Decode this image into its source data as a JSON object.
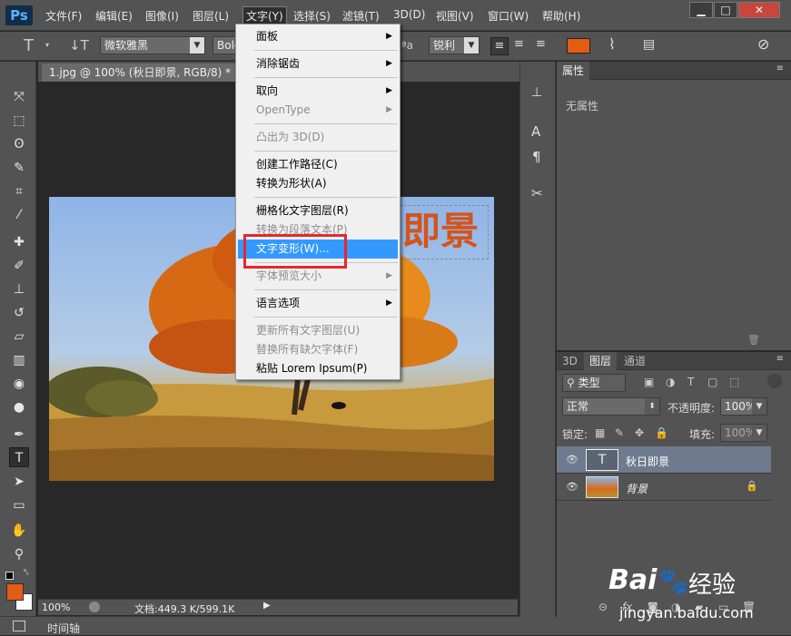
{
  "app": {
    "logo": "Ps"
  },
  "menubar": {
    "items": [
      "文件(F)",
      "编辑(E)",
      "图像(I)",
      "图层(L)",
      "文字(Y)",
      "选择(S)",
      "滤镜(T)",
      "3D(D)",
      "视图(V)",
      "窗口(W)",
      "帮助(H)"
    ],
    "active_index": 4
  },
  "window_controls": {
    "minimize": "▁",
    "maximize": "□",
    "close": "✕"
  },
  "options": {
    "font_family": "微软雅黑",
    "font_style": "Bold",
    "aa_label": "ªa",
    "antialias": "锐利",
    "color_swatch": "#e45c12"
  },
  "document": {
    "tab_title": "1.jpg @ 100% (秋日即景, RGB/8) *",
    "tab_close": "×",
    "canvas_text": "即景",
    "zoom": "100%",
    "doc_size": "文档:449.3 K/599.1K",
    "timeline_label": "时间轴"
  },
  "context_menu": {
    "items": [
      {
        "label": "面板",
        "submenu": true,
        "disabled": false
      },
      {
        "sep": true
      },
      {
        "label": "消除锯齿",
        "submenu": true,
        "disabled": false
      },
      {
        "sep": true
      },
      {
        "label": "取向",
        "submenu": true,
        "disabled": false
      },
      {
        "label": "OpenType",
        "submenu": true,
        "disabled": true
      },
      {
        "sep": true
      },
      {
        "label": "凸出为 3D(D)",
        "submenu": false,
        "disabled": true
      },
      {
        "sep": true
      },
      {
        "label": "创建工作路径(C)",
        "submenu": false,
        "disabled": false
      },
      {
        "label": "转换为形状(A)",
        "submenu": false,
        "disabled": false
      },
      {
        "sep": true
      },
      {
        "label": "栅格化文字图层(R)",
        "submenu": false,
        "disabled": false
      },
      {
        "label": "转换为段落文本(P)",
        "submenu": false,
        "disabled": true
      },
      {
        "label": "文字变形(W)...",
        "submenu": false,
        "disabled": false,
        "highlighted": true
      },
      {
        "sep": true
      },
      {
        "label": "字体预览大小",
        "submenu": true,
        "disabled": true
      },
      {
        "sep": true
      },
      {
        "label": "语言选项",
        "submenu": true,
        "disabled": false
      },
      {
        "sep": true
      },
      {
        "label": "更新所有文字图层(U)",
        "submenu": false,
        "disabled": true
      },
      {
        "label": "替换所有缺欠字体(F)",
        "submenu": false,
        "disabled": true
      },
      {
        "label": "粘贴 Lorem Ipsum(P)",
        "submenu": false,
        "disabled": false
      }
    ]
  },
  "properties_panel": {
    "title": "属性",
    "empty_text": "无属性"
  },
  "layers_panel": {
    "tabs": [
      "3D",
      "图层",
      "通道"
    ],
    "active_tab": 1,
    "filter_kind": "类型",
    "blend_mode": "正常",
    "opacity_label": "不透明度:",
    "opacity_value": "100%",
    "lock_label": "锁定:",
    "fill_label": "填充:",
    "fill_value": "100%",
    "layers": [
      {
        "name": "秋日即景",
        "type": "text",
        "selected": true
      },
      {
        "name": "背景",
        "type": "image",
        "locked": true,
        "selected": false
      }
    ]
  },
  "watermark": {
    "brand": "Bai",
    "brand_suffix": "经验",
    "url": "jingyan.baidu.com"
  },
  "colors": {
    "foreground": "#e45c12",
    "background": "#ffffff",
    "highlight": "#3399ff",
    "annotation_box": "#e8262c",
    "canvas_text": "#d4541a"
  }
}
